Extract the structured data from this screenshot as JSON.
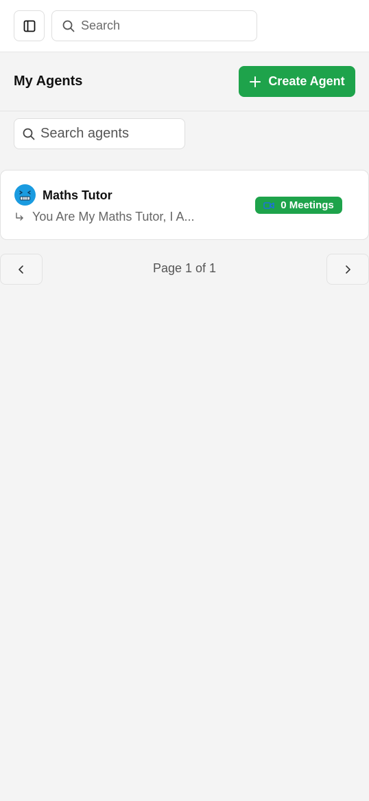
{
  "topbar": {
    "search_placeholder": "Search"
  },
  "header": {
    "title": "My Agents",
    "create_button_label": "Create Agent"
  },
  "filters": {
    "search_placeholder": "Search agents"
  },
  "agents": [
    {
      "name": "Maths Tutor",
      "instructions": "You Are My Maths Tutor, I A...",
      "meetings_label": "0 Meetings"
    }
  ],
  "pagination": {
    "label": "Page 1 of 1"
  },
  "colors": {
    "accent": "#1ea34b",
    "avatar": "#1a9be0",
    "video_icon": "#1e73d8"
  },
  "icons": {
    "sidebar_toggle": "panel-left-icon",
    "search": "search-icon",
    "create": "plus-icon",
    "agent_avatar": "grimace-emoji-avatar",
    "instructions": "corner-down-right-icon",
    "meetings": "video-icon",
    "prev": "chevron-left-icon",
    "next": "chevron-right-icon"
  }
}
